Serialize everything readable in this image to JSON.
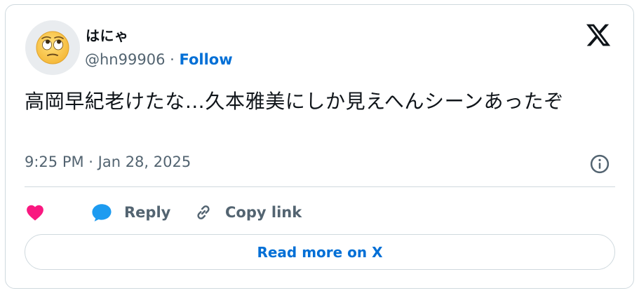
{
  "tweet": {
    "author": {
      "display_name": "はにゃ",
      "handle": "@hn99906",
      "separator": " · ",
      "follow_label": "Follow",
      "avatar_icon": "face-with-rolling-eyes-emoji"
    },
    "text": "高岡早紀老けたな…久本雅美にしか見えへんシーンあったぞ",
    "timestamp": "9:25 PM · Jan 28, 2025",
    "actions": {
      "like_icon": "heart-icon",
      "reply_label": "Reply",
      "copy_link_label": "Copy link"
    },
    "read_more_label": "Read more on X"
  },
  "colors": {
    "accent": "#006fd6",
    "like": "#f91880",
    "reply": "#1d9bf0",
    "muted": "#536471",
    "border": "#cfd9de",
    "text": "#0f1419"
  }
}
